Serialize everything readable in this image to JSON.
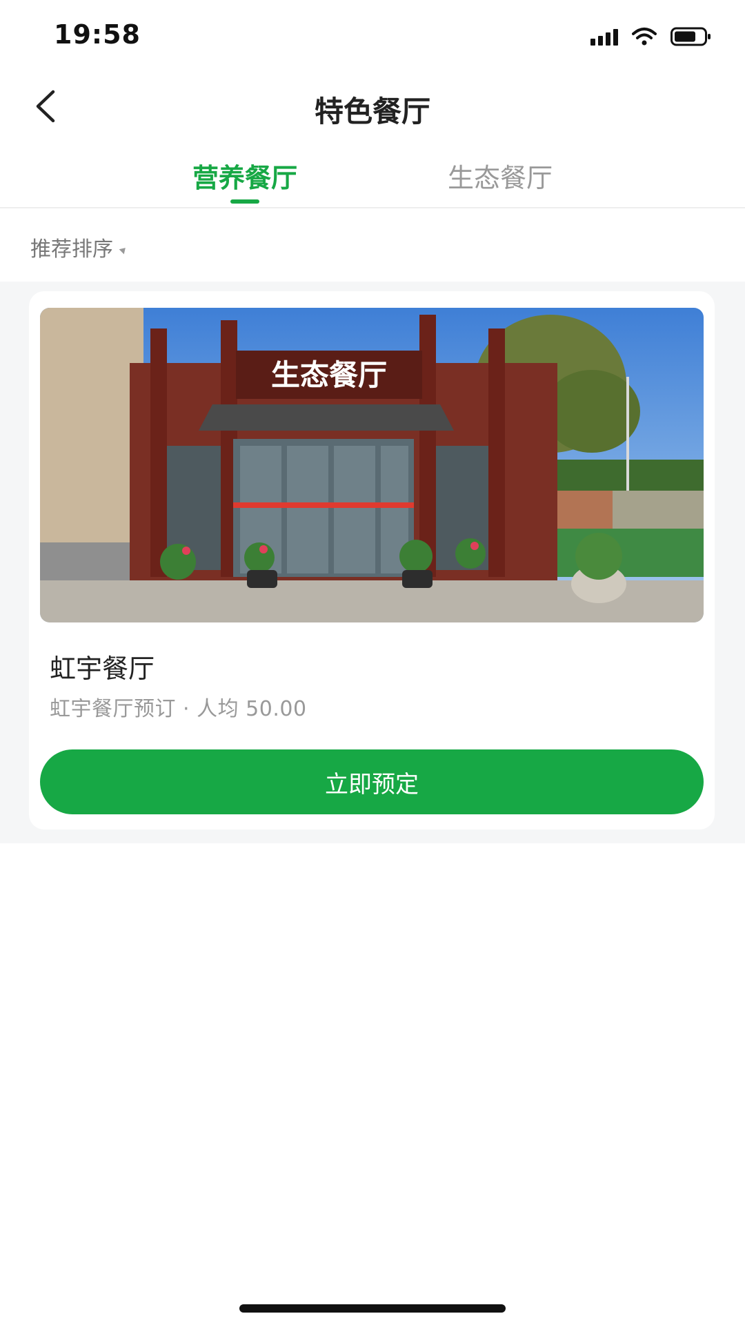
{
  "status_bar": {
    "time": "19:58",
    "icons": [
      "signal-icon",
      "wifi-icon",
      "battery-icon"
    ]
  },
  "nav": {
    "back_icon": "chevron-left-icon",
    "title": "特色餐厅"
  },
  "tabs": [
    {
      "label": "营养餐厅",
      "active": true
    },
    {
      "label": "生态餐厅",
      "active": false
    }
  ],
  "sort": {
    "label": "推荐排序",
    "icon": "sort-caret-icon"
  },
  "restaurants": [
    {
      "image_sign_text": "生态餐厅",
      "name": "虹宇餐厅",
      "meta": "虹宇餐厅预订 · 人均 50.00",
      "button_label": "立即预定"
    }
  ],
  "colors": {
    "accent": "#17a845",
    "list_background": "#f5f6f7",
    "muted_text": "#999999"
  }
}
